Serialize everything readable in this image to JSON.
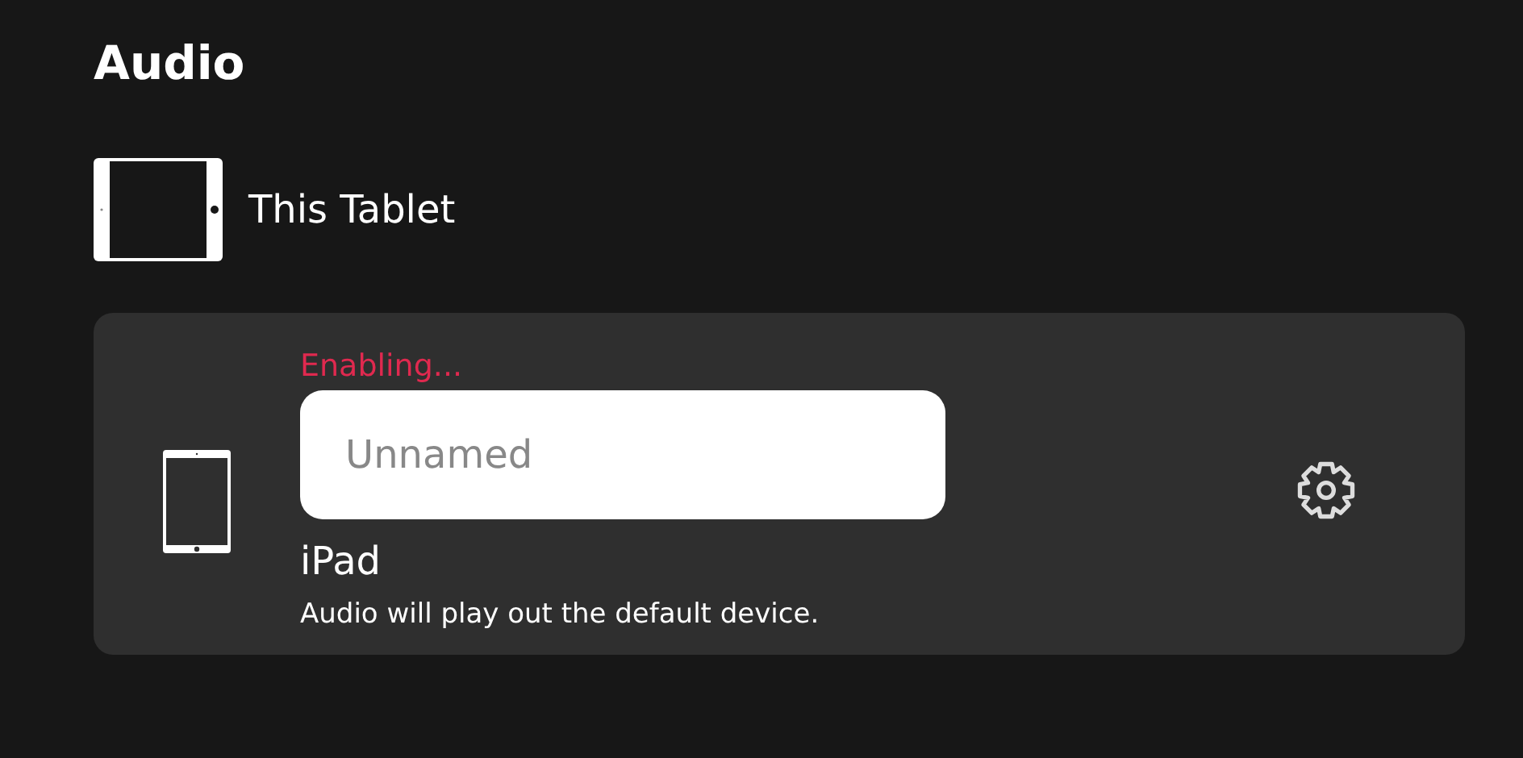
{
  "heading": "Audio",
  "this_device": {
    "label": "This Tablet"
  },
  "devices": [
    {
      "status": "Enabling...",
      "name_field": {
        "placeholder": "Unnamed"
      },
      "model": "iPad",
      "description": "Audio will play out the default device."
    }
  ]
}
